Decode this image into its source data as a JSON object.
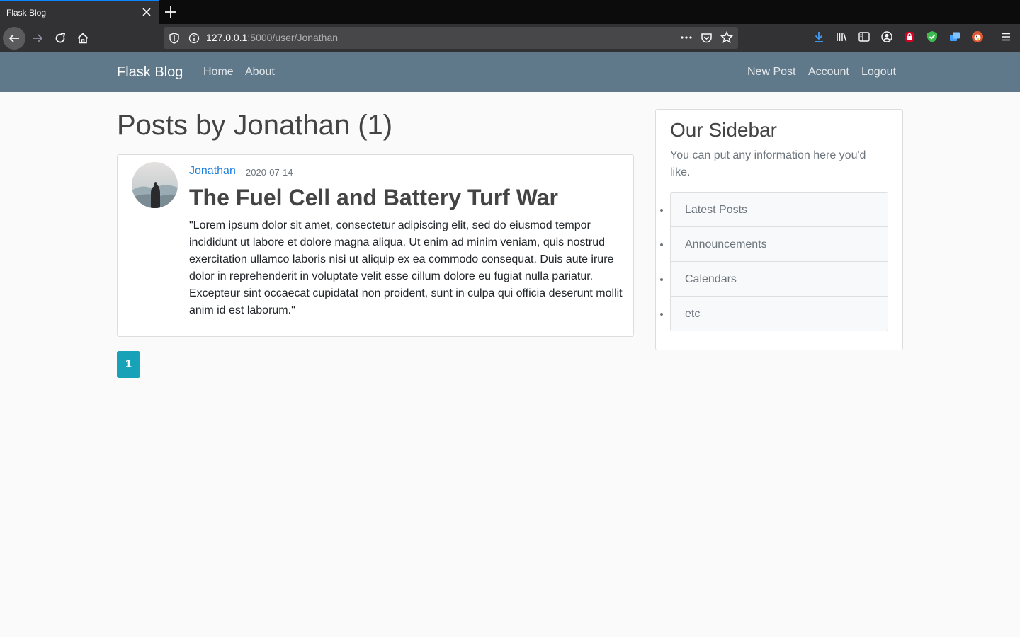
{
  "browser": {
    "tab_title": "Flask Blog",
    "url_host": "127.0.0.1",
    "url_rest": ":5000/user/Jonathan",
    "toolbar_icons": [
      "download-icon",
      "library-icon",
      "sidebar-icon",
      "account-icon",
      "lock-extension-icon",
      "shield-extension-icon",
      "extension-icon",
      "duckduckgo-icon",
      "menu-icon"
    ]
  },
  "site_nav": {
    "brand": "Flask Blog",
    "left_links": [
      "Home",
      "About"
    ],
    "right_links": [
      "New Post",
      "Account",
      "Logout"
    ]
  },
  "main": {
    "page_title": "Posts by Jonathan (1)",
    "post": {
      "author": "Jonathan",
      "date": "2020-07-14",
      "title": "The Fuel Cell and Battery Turf War",
      "body": "\"Lorem ipsum dolor sit amet, consectetur adipiscing elit, sed do eiusmod tempor incididunt ut labore et dolore magna aliqua. Ut enim ad minim veniam, quis nostrud exercitation ullamco laboris nisi ut aliquip ex ea commodo consequat. Duis aute irure dolor in reprehenderit in voluptate velit esse cillum dolore eu fugiat nulla pariatur. Excepteur sint occaecat cupidatat non proident, sunt in culpa qui officia deserunt mollit anim id est laborum.\""
    },
    "pagination": {
      "current_page": "1"
    }
  },
  "sidebar": {
    "title": "Our Sidebar",
    "text": "You can put any information here you'd like.",
    "items": [
      "Latest Posts",
      "Announcements",
      "Calendars",
      "etc"
    ]
  },
  "colors": {
    "nav_bg": "#5f788a",
    "link": "#1a7ee0",
    "page_button": "#17a2b8",
    "page_bg": "#fafafa"
  }
}
